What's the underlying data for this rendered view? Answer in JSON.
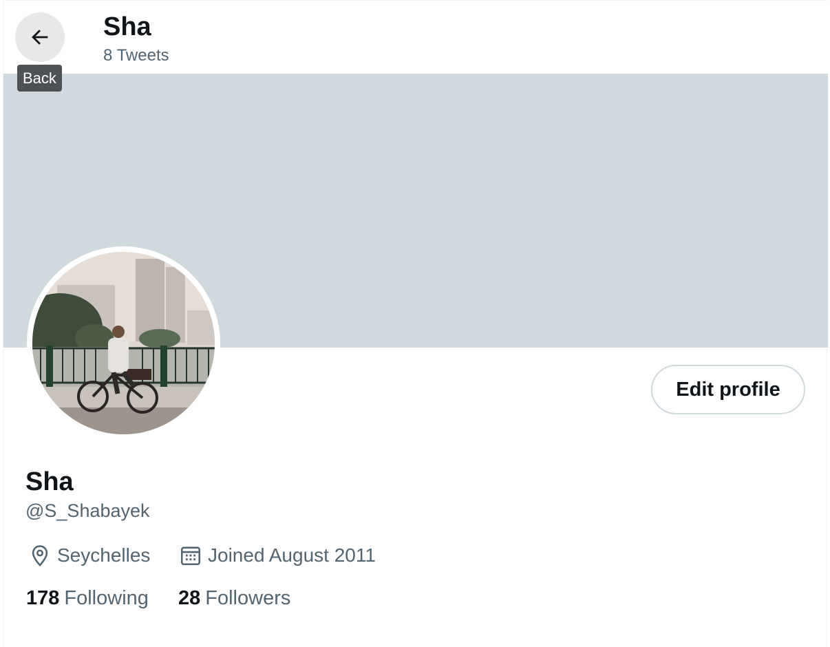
{
  "header": {
    "title": "Sha",
    "subtitle": "8 Tweets",
    "back_icon": "arrow-left-icon",
    "back_tooltip": "Back"
  },
  "banner": {
    "color": "#cfd9de"
  },
  "avatar": {
    "description_icon": "profile-photo-cyclist"
  },
  "actions": {
    "edit_profile_label": "Edit profile"
  },
  "profile": {
    "display_name": "Sha",
    "handle": "@S_Shabayek",
    "location": "Seychelles",
    "location_icon": "location-pin-icon",
    "joined": "Joined August 2011",
    "joined_icon": "calendar-icon"
  },
  "stats": {
    "following_count": "178",
    "following_label": "Following",
    "followers_count": "28",
    "followers_label": "Followers"
  },
  "colors": {
    "text_primary": "#0f1419",
    "text_secondary": "#536471",
    "border": "#cfd9de"
  }
}
